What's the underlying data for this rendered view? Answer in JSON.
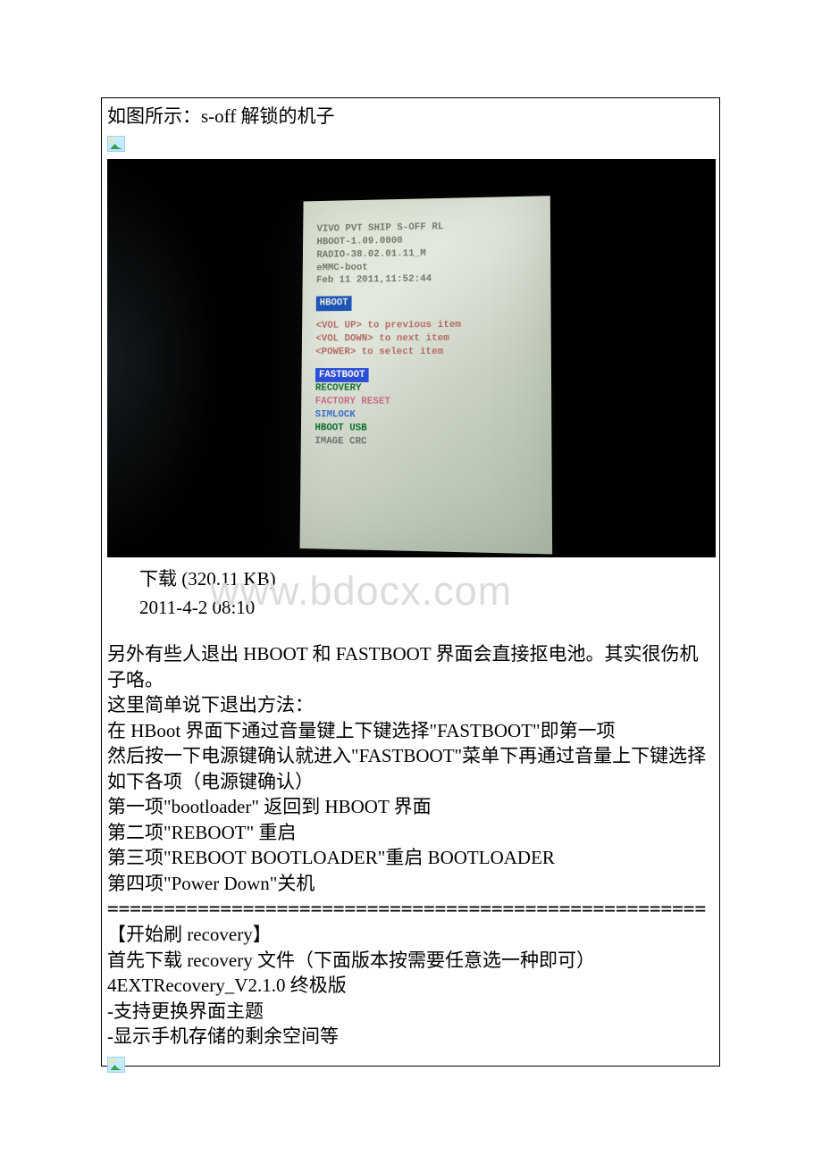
{
  "top_text": "如图所示：s-off 解锁的机子",
  "phone": {
    "line1": "VIVO PVT SHIP S-OFF RL",
    "line2": "HBOOT-1.09.0000",
    "line3": "RADIO-38.02.01.11_M",
    "line4": "eMMC-boot",
    "line5": "Feb 11 2011,11:52:44",
    "hboot": "HBOOT",
    "hint1": "<VOL UP> to previous item",
    "hint2": "<VOL DOWN> to next item",
    "hint3": "<POWER> to select item",
    "menu_fastboot": "FASTBOOT",
    "menu_recovery": "RECOVERY",
    "menu_factory": "FACTORY RESET",
    "menu_simlock": "SIMLOCK",
    "menu_hbootusb": "HBOOT USB",
    "menu_imagecrc": "IMAGE CRC"
  },
  "download_label": "下载 (320.11 KB)",
  "date_label": "2011-4-2 08:10",
  "watermark": "www.bdocx.com",
  "body": {
    "p1": "另外有些人退出 HBOOT 和 FASTBOOT 界面会直接抠电池。其实很伤机子咯。",
    "p2": "这里简单说下退出方法：",
    "p3": "在 HBoot 界面下通过音量键上下键选择\"FASTBOOT\"即第一项",
    "p4": "然后按一下电源键确认就进入\"FASTBOOT\"菜单下再通过音量上下键选择如下各项（电源键确认）",
    "p5": "第一项\"bootloader\" 返回到 HBOOT 界面",
    "p6": "第二项\"REBOOT\" 重启",
    "p7": "第三项\"REBOOT BOOTLOADER\"重启 BOOTLOADER",
    "p8": "第四项\"Power Down\"关机",
    "divider": "=====================================================",
    "p9": "【开始刷 recovery】",
    "p10": "首先下载 recovery 文件（下面版本按需要任意选一种即可）",
    "p11": "4EXTRecovery_V2.1.0 终极版",
    "p12": "-支持更换界面主题",
    "p13": "-显示手机存储的剩余空间等"
  }
}
